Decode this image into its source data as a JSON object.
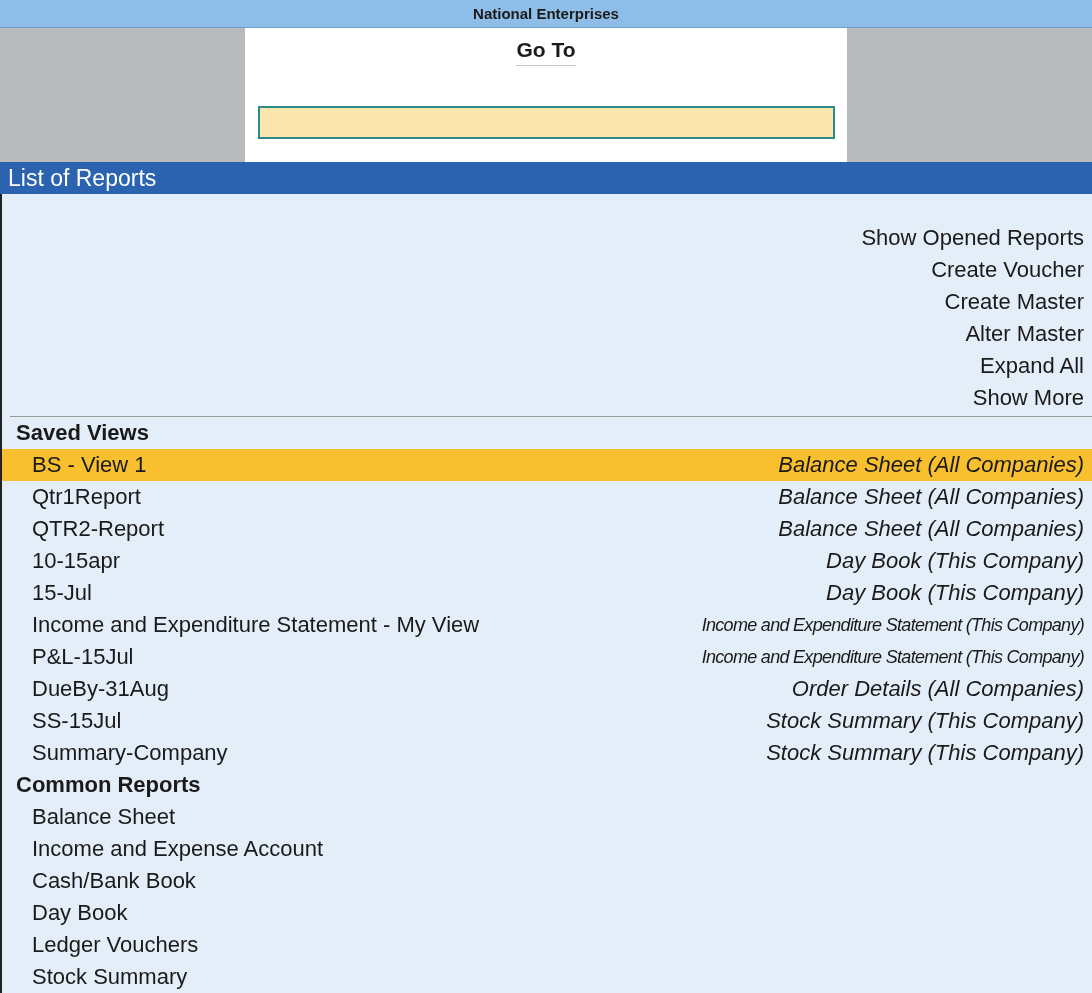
{
  "window": {
    "title": "National Enterprises"
  },
  "goto": {
    "title": "Go To"
  },
  "panel": {
    "title": "List of Reports"
  },
  "actions": [
    {
      "label": "Show Opened Reports"
    },
    {
      "label": "Create Voucher"
    },
    {
      "label": "Create Master"
    },
    {
      "label": "Alter Master"
    },
    {
      "label": "Expand All"
    },
    {
      "label": "Show More"
    }
  ],
  "sections": [
    {
      "title": "Saved Views",
      "items": [
        {
          "name": "BS - View 1",
          "report": "Balance Sheet (All Companies)",
          "selected": true
        },
        {
          "name": "Qtr1Report",
          "report": "Balance Sheet (All Companies)",
          "selected": false
        },
        {
          "name": "QTR2-Report",
          "report": "Balance Sheet (All Companies)",
          "selected": false
        },
        {
          "name": "10-15apr",
          "report": "Day Book (This Company)",
          "selected": false
        },
        {
          "name": "15-Jul",
          "report": "Day Book (This Company)",
          "selected": false
        },
        {
          "name": "Income and Expenditure Statement - My View",
          "report": "Income and Expenditure Statement (This Company)",
          "selected": false
        },
        {
          "name": "P&L-15Jul",
          "report": "Income and Expenditure Statement (This Company)",
          "selected": false
        },
        {
          "name": "DueBy-31Aug",
          "report": "Order Details (All Companies)",
          "selected": false
        },
        {
          "name": "SS-15Jul",
          "report": "Stock Summary (This Company)",
          "selected": false
        },
        {
          "name": "Summary-Company",
          "report": "Stock Summary (This Company)",
          "selected": false
        }
      ]
    },
    {
      "title": "Common Reports",
      "items": [
        {
          "name": "Balance Sheet",
          "selected": false
        },
        {
          "name": "Income and Expense Account",
          "selected": false
        },
        {
          "name": "Cash/Bank Book",
          "selected": false
        },
        {
          "name": "Day Book",
          "selected": false
        },
        {
          "name": "Ledger Vouchers",
          "selected": false
        },
        {
          "name": "Stock Summary",
          "selected": false
        }
      ]
    }
  ]
}
